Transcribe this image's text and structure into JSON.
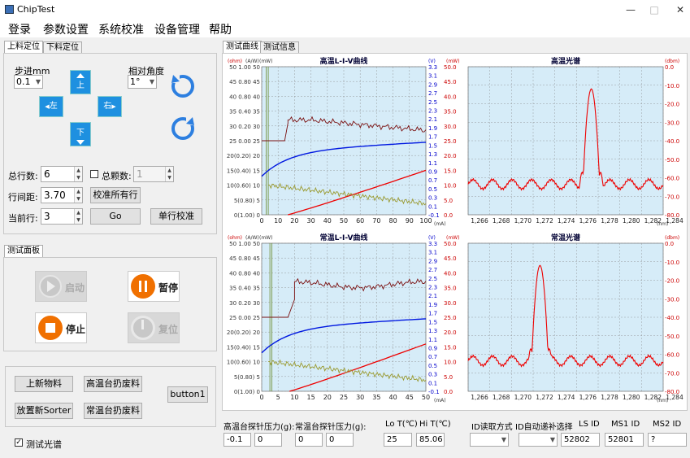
{
  "window": {
    "title": "ChipTest",
    "minimize": "—",
    "maximize": "□",
    "close": "✕"
  },
  "menu": [
    "登录",
    "参数设置",
    "系统校准",
    "设备管理",
    "帮助"
  ],
  "left_tabs": [
    "上料定位",
    "下料定位"
  ],
  "step": {
    "label": "步进mm",
    "value": "0.1"
  },
  "angle": {
    "label": "相对角度",
    "value": "1°"
  },
  "dir_buttons": {
    "up": "上",
    "left": "左",
    "right": "右",
    "down": "下"
  },
  "rows": {
    "total_label": "总行数:",
    "total_value": "6",
    "total_count_label": "总颗数:",
    "total_count_value": "1",
    "spacing_label": "行间距:",
    "spacing_value": "3.70",
    "calibrate_all": "校准所有行",
    "current_label": "当前行:",
    "current_value": "3",
    "go": "Go",
    "single_calibrate": "单行校准"
  },
  "test_panel": {
    "tab": "测试面板",
    "start": "启动",
    "pause": "暂停",
    "stop": "停止",
    "reset": "复位"
  },
  "bottom_buttons": {
    "new_material": "上新物料",
    "hot_discard": "高温台扔废料",
    "button1": "button1",
    "new_sorter": "放置新Sorter",
    "normal_discard": "常温台扔废料"
  },
  "spectrum_check": {
    "label": "测试光谱",
    "checked": true
  },
  "right_tabs": [
    "测试曲线",
    "测试信息"
  ],
  "charts": {
    "liv_hot": {
      "title": "高温L-I-V曲线",
      "xmax": 100
    },
    "spec_hot": {
      "title": "高温光谱",
      "peak": 1.2775
    },
    "liv_normal": {
      "title": "常温L-I-V曲线",
      "xmax": 50
    },
    "spec_normal": {
      "title": "常温光谱",
      "peak": 1.2725
    },
    "axis_units": {
      "ohm": "(ohm)",
      "aw": "(A/W)",
      "mw": "(mW)",
      "v": "(V)",
      "mw2": "(mW)",
      "dbm": "(dbm)",
      "ma": "(mA)",
      "nm": "(nm)"
    },
    "liv_left_ticks": [
      "50 1.00 50",
      "45 0.80 45",
      "40 0.80 40",
      "35 0.40 35",
      "30 0.20 30",
      "25 0.00 25",
      "20(0.20) 20",
      "15(0.40) 15",
      "10(0.60) 10",
      "5(0.80) 5",
      "0(1.00) 0"
    ],
    "liv_v_ticks": [
      "3.3",
      "3.1",
      "2.9",
      "2.7",
      "2.5",
      "2.3",
      "2.1",
      "1.9",
      "1.7",
      "1.5",
      "1.3",
      "1.1",
      "0.9",
      "0.7",
      "0.5",
      "0.3",
      "0.1",
      "-0.1"
    ],
    "liv_mw_ticks": [
      "50.0",
      "45.0",
      "40.0",
      "35.0",
      "30.0",
      "25.0",
      "20.0",
      "15.0",
      "10.0",
      "5.0",
      "0.0"
    ],
    "hot_x_ticks": [
      "0",
      "10",
      "20",
      "30",
      "40",
      "50",
      "60",
      "70",
      "80",
      "90",
      "100"
    ],
    "normal_x_ticks": [
      "0",
      "5",
      "10",
      "15",
      "20",
      "25",
      "30",
      "35",
      "40",
      "45",
      "50"
    ],
    "spec_dbm_ticks": [
      "0.0",
      "-10.0",
      "-20.0",
      "-30.0",
      "-40.0",
      "-50.0",
      "-60.0",
      "-70.0",
      "-80.0"
    ],
    "spec_x_ticks": [
      "1,266",
      "1,268",
      "1,270",
      "1,272",
      "1,274",
      "1,276",
      "1,278",
      "1,280",
      "1,282",
      "1,284"
    ]
  },
  "bottom_params": {
    "hot_pressure_label": "高温台探针压力(g):",
    "hot_p1": "-0.1",
    "hot_p2": "0",
    "normal_pressure_label": "常温台探针压力(g):",
    "normal_p1": "0",
    "normal_p2": "0",
    "lo_label": "Lo T(℃)",
    "lo_value": "25",
    "hi_label": "Hi T(℃)",
    "hi_value": "85.06",
    "id_read_label": "ID读取方式",
    "id_auto_label": "ID自动递补选择",
    "ls_label": "LS ID",
    "ls_value": "52802",
    "ms1_label": "MS1 ID",
    "ms1_value": "52801",
    "ms2_label": "MS2 ID",
    "ms2_value": "?"
  }
}
